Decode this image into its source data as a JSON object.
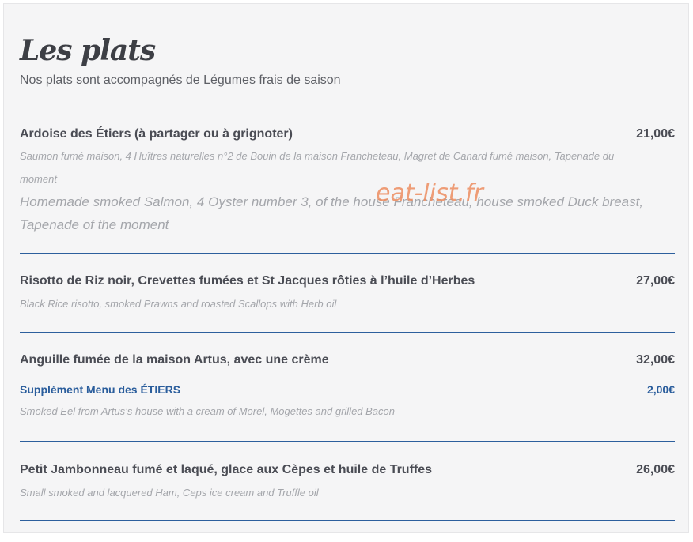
{
  "section": {
    "title": "Les plats",
    "subtitle": "Nos plats sont accompagnés de Légumes frais de saison"
  },
  "items": [
    {
      "name": "Ardoise des Étiers (à partager ou à grignoter)",
      "price": "21,00€",
      "desc_fr": "Saumon fumé maison, 4 Huîtres naturelles n°2 de Bouin de la maison Francheteau, Magret de Canard fumé maison, Tapenade du moment",
      "desc_en": "Homemade smoked Salmon, 4 Oyster number 3, of the house Francheteau, house smoked Duck breast, Tapenade of the moment"
    },
    {
      "name": "Risotto de Riz noir, Crevettes fumées et St Jacques rôties à l’huile d’Herbes",
      "price": "27,00€",
      "desc": "Black Rice risotto, smoked Prawns and roasted Scallops with Herb oil"
    },
    {
      "name": "Anguille fumée de la maison Artus, avec une crème",
      "price": "32,00€",
      "supplement_name": "Supplément Menu des ÉTIERS",
      "supplement_price": "2,00€",
      "desc": "Smoked Eel from Artus’s house with a cream of Morel, Mogettes and grilled Bacon"
    },
    {
      "name": "Petit Jambonneau fumé et laqué, glace aux Cèpes et huile de Truffes",
      "price": "26,00€",
      "desc": "Small smoked and lacquered Ham, Ceps ice cream and Truffle oil"
    }
  ],
  "watermark": "eat-list.fr",
  "colors": {
    "divider": "#2d5f9d",
    "supplement": "#2a5d9c",
    "watermark": "#ec8c5f"
  }
}
